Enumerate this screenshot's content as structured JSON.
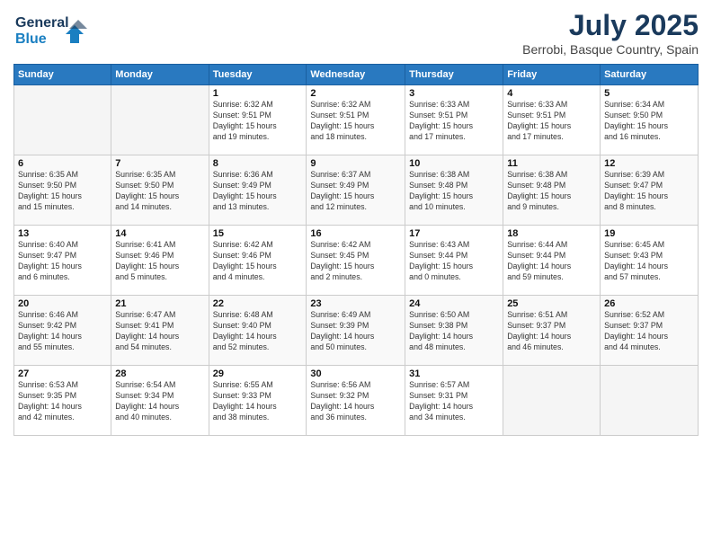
{
  "logo": {
    "line1": "General",
    "line2": "Blue"
  },
  "header": {
    "month": "July 2025",
    "location": "Berrobi, Basque Country, Spain"
  },
  "weekdays": [
    "Sunday",
    "Monday",
    "Tuesday",
    "Wednesday",
    "Thursday",
    "Friday",
    "Saturday"
  ],
  "weeks": [
    [
      {
        "day": "",
        "info": ""
      },
      {
        "day": "",
        "info": ""
      },
      {
        "day": "1",
        "info": "Sunrise: 6:32 AM\nSunset: 9:51 PM\nDaylight: 15 hours\nand 19 minutes."
      },
      {
        "day": "2",
        "info": "Sunrise: 6:32 AM\nSunset: 9:51 PM\nDaylight: 15 hours\nand 18 minutes."
      },
      {
        "day": "3",
        "info": "Sunrise: 6:33 AM\nSunset: 9:51 PM\nDaylight: 15 hours\nand 17 minutes."
      },
      {
        "day": "4",
        "info": "Sunrise: 6:33 AM\nSunset: 9:51 PM\nDaylight: 15 hours\nand 17 minutes."
      },
      {
        "day": "5",
        "info": "Sunrise: 6:34 AM\nSunset: 9:50 PM\nDaylight: 15 hours\nand 16 minutes."
      }
    ],
    [
      {
        "day": "6",
        "info": "Sunrise: 6:35 AM\nSunset: 9:50 PM\nDaylight: 15 hours\nand 15 minutes."
      },
      {
        "day": "7",
        "info": "Sunrise: 6:35 AM\nSunset: 9:50 PM\nDaylight: 15 hours\nand 14 minutes."
      },
      {
        "day": "8",
        "info": "Sunrise: 6:36 AM\nSunset: 9:49 PM\nDaylight: 15 hours\nand 13 minutes."
      },
      {
        "day": "9",
        "info": "Sunrise: 6:37 AM\nSunset: 9:49 PM\nDaylight: 15 hours\nand 12 minutes."
      },
      {
        "day": "10",
        "info": "Sunrise: 6:38 AM\nSunset: 9:48 PM\nDaylight: 15 hours\nand 10 minutes."
      },
      {
        "day": "11",
        "info": "Sunrise: 6:38 AM\nSunset: 9:48 PM\nDaylight: 15 hours\nand 9 minutes."
      },
      {
        "day": "12",
        "info": "Sunrise: 6:39 AM\nSunset: 9:47 PM\nDaylight: 15 hours\nand 8 minutes."
      }
    ],
    [
      {
        "day": "13",
        "info": "Sunrise: 6:40 AM\nSunset: 9:47 PM\nDaylight: 15 hours\nand 6 minutes."
      },
      {
        "day": "14",
        "info": "Sunrise: 6:41 AM\nSunset: 9:46 PM\nDaylight: 15 hours\nand 5 minutes."
      },
      {
        "day": "15",
        "info": "Sunrise: 6:42 AM\nSunset: 9:46 PM\nDaylight: 15 hours\nand 4 minutes."
      },
      {
        "day": "16",
        "info": "Sunrise: 6:42 AM\nSunset: 9:45 PM\nDaylight: 15 hours\nand 2 minutes."
      },
      {
        "day": "17",
        "info": "Sunrise: 6:43 AM\nSunset: 9:44 PM\nDaylight: 15 hours\nand 0 minutes."
      },
      {
        "day": "18",
        "info": "Sunrise: 6:44 AM\nSunset: 9:44 PM\nDaylight: 14 hours\nand 59 minutes."
      },
      {
        "day": "19",
        "info": "Sunrise: 6:45 AM\nSunset: 9:43 PM\nDaylight: 14 hours\nand 57 minutes."
      }
    ],
    [
      {
        "day": "20",
        "info": "Sunrise: 6:46 AM\nSunset: 9:42 PM\nDaylight: 14 hours\nand 55 minutes."
      },
      {
        "day": "21",
        "info": "Sunrise: 6:47 AM\nSunset: 9:41 PM\nDaylight: 14 hours\nand 54 minutes."
      },
      {
        "day": "22",
        "info": "Sunrise: 6:48 AM\nSunset: 9:40 PM\nDaylight: 14 hours\nand 52 minutes."
      },
      {
        "day": "23",
        "info": "Sunrise: 6:49 AM\nSunset: 9:39 PM\nDaylight: 14 hours\nand 50 minutes."
      },
      {
        "day": "24",
        "info": "Sunrise: 6:50 AM\nSunset: 9:38 PM\nDaylight: 14 hours\nand 48 minutes."
      },
      {
        "day": "25",
        "info": "Sunrise: 6:51 AM\nSunset: 9:37 PM\nDaylight: 14 hours\nand 46 minutes."
      },
      {
        "day": "26",
        "info": "Sunrise: 6:52 AM\nSunset: 9:37 PM\nDaylight: 14 hours\nand 44 minutes."
      }
    ],
    [
      {
        "day": "27",
        "info": "Sunrise: 6:53 AM\nSunset: 9:35 PM\nDaylight: 14 hours\nand 42 minutes."
      },
      {
        "day": "28",
        "info": "Sunrise: 6:54 AM\nSunset: 9:34 PM\nDaylight: 14 hours\nand 40 minutes."
      },
      {
        "day": "29",
        "info": "Sunrise: 6:55 AM\nSunset: 9:33 PM\nDaylight: 14 hours\nand 38 minutes."
      },
      {
        "day": "30",
        "info": "Sunrise: 6:56 AM\nSunset: 9:32 PM\nDaylight: 14 hours\nand 36 minutes."
      },
      {
        "day": "31",
        "info": "Sunrise: 6:57 AM\nSunset: 9:31 PM\nDaylight: 14 hours\nand 34 minutes."
      },
      {
        "day": "",
        "info": ""
      },
      {
        "day": "",
        "info": ""
      }
    ]
  ]
}
